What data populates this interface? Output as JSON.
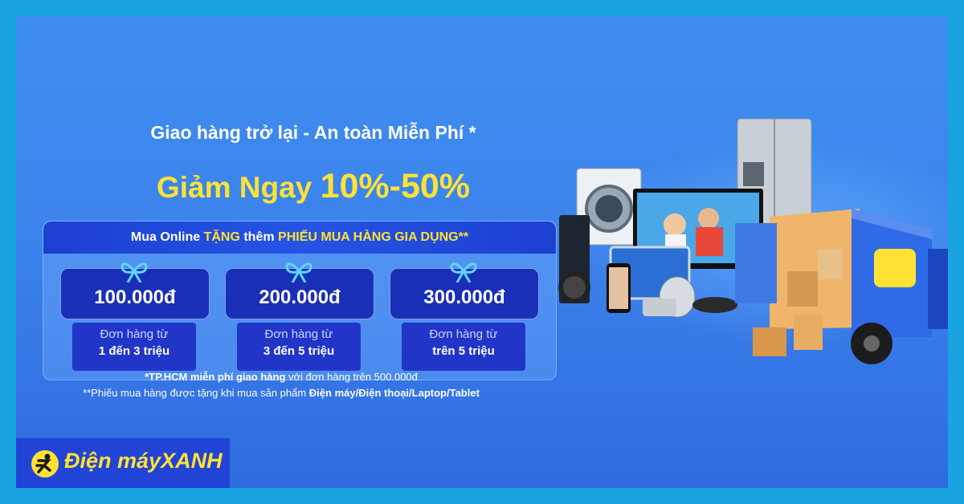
{
  "headline": {
    "line1": "Giao hàng trở lại - An toàn Miễn Phí *",
    "line2_prefix": "Giảm Ngay ",
    "line2_range": "10%-50%"
  },
  "promo": {
    "head_part1": "Mua Online ",
    "head_part2": "TẶNG",
    "head_part3": " thêm ",
    "head_part4": "PHIẾU MUA HÀNG GIA DỤNG**",
    "coupons": [
      {
        "amount": "100.000đ",
        "label": "Đơn hàng từ",
        "range": "1 đến 3 triệu"
      },
      {
        "amount": "200.000đ",
        "label": "Đơn hàng từ",
        "range": "3 đến 5 triệu"
      },
      {
        "amount": "300.000đ",
        "label": "Đơn hàng từ",
        "range": "trên 5 triệu"
      }
    ]
  },
  "notes": {
    "n1_bold": "*TP.HCM miễn phí giao hàng",
    "n1_rest": " với đơn hàng trên 500.000đ",
    "n2_rest": "**Phiếu mua hàng được tặng khi mua sản phẩm ",
    "n2_bold": "Điện máy/Điện thoại/Laptop/Tablet"
  },
  "brand": {
    "name_part1": "Điện máy",
    "name_part2": "XANH"
  },
  "colors": {
    "accent_yellow": "#ffe234",
    "frame_cyan": "#19a3e0",
    "banner_blue": "#3e8ff0",
    "coupon_navy": "#1a2fb8"
  },
  "icons": [
    "gift-bow-icon",
    "running-man-logo-icon",
    "truck-illustration",
    "appliances-illustration"
  ]
}
